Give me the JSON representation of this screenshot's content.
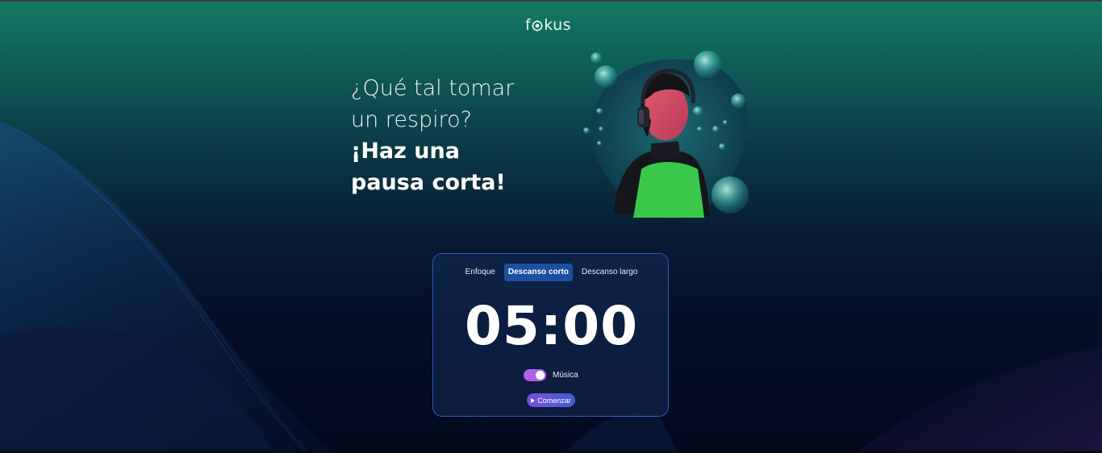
{
  "brand": {
    "logo_text_before": "f",
    "logo_text_after": "kus"
  },
  "hero": {
    "line1": "¿Qué tal tomar",
    "line2": "un respiro?",
    "line3": "¡Haz una",
    "line4": "pausa corta!"
  },
  "timer_card": {
    "tabs": [
      {
        "label": "Enfoque",
        "active": false
      },
      {
        "label": "Descanso corto",
        "active": true
      },
      {
        "label": "Descanso largo",
        "active": false
      }
    ],
    "time": "05:00",
    "music_label": "Música",
    "music_on": true,
    "start_label": "Comenzar"
  },
  "colors": {
    "accent_purple": "#b060e8",
    "tab_active": "#1d4ea0",
    "card_border": "#2a5bb8",
    "bg_top": "#147a63",
    "bg_bottom": "#020a1d"
  }
}
